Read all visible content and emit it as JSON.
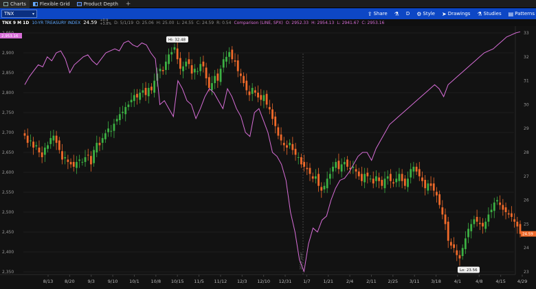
{
  "tabs": [
    {
      "label": "Charts",
      "active": true
    },
    {
      "label": "Flexible Grid",
      "active": false
    },
    {
      "label": "Product Depth",
      "active": false
    }
  ],
  "symbol_input": {
    "value": "TNX"
  },
  "toolbar": {
    "share": "Share",
    "flask": "",
    "d_label": "D",
    "style": "Style",
    "drawings": "Drawings",
    "studies": "Studies",
    "patterns": "Patterns"
  },
  "info": {
    "spec": "TNX 9 M 1D",
    "description": "10-YR TREASURY INDEX",
    "last": "24.59",
    "change_top": "+0.9",
    "change_bottom": "+3.8%",
    "ohlc": [
      "D: 5/1/19",
      "O: 25.06",
      "H: 25.00",
      "L: 24.55",
      "C: 24.59",
      "R: 0.54"
    ],
    "comparison_label": "Comparison (LINE, SPX)",
    "comparison_values": [
      "O: 2952.33",
      "H: 2954.13",
      "L: 2941.67",
      "C: 2953.16"
    ]
  },
  "colors": {
    "up": "#3cb043",
    "down": "#f06a2a",
    "comparison": "#d86ed8",
    "toolbar_bg": "#0d47c5"
  },
  "chart_data": {
    "type": "line",
    "description_series": [
      {
        "name": "TNX",
        "kind": "candlestick",
        "axis": "right"
      },
      {
        "name": "SPX",
        "kind": "line",
        "axis": "left"
      }
    ],
    "left_axis": {
      "ticks": [
        "2,950",
        "2,900",
        "2,850",
        "2,800",
        "2,750",
        "2,700",
        "2,650",
        "2,600",
        "2,550",
        "2,500",
        "2,450",
        "2,400",
        "2,350"
      ],
      "range": [
        2350,
        2950
      ],
      "current_label": "2,953.16"
    },
    "right_axis": {
      "ticks": [
        "33",
        "32",
        "31",
        "30",
        "29",
        "28",
        "27",
        "26",
        "25",
        "24",
        "23"
      ],
      "range": [
        23,
        33
      ],
      "current_label": "24.59"
    },
    "x_labels": [
      "8/13",
      "8/20",
      "9/3",
      "9/10",
      "10/1",
      "10/8",
      "10/15",
      "11/5",
      "11/12",
      "12/3",
      "12/10",
      "12/31",
      "1/7",
      "1/21",
      "2/4",
      "2/11",
      "2/25",
      "3/11",
      "3/18",
      "4/1",
      "4/8",
      "4/15",
      "4/29"
    ],
    "annotations": [
      {
        "text": "Hi: 32.48"
      },
      {
        "text": "Lo: 23.56"
      },
      {
        "text": "2019 year"
      }
    ],
    "tnx_close": [
      28.7,
      28.4,
      28.5,
      28.2,
      28.3,
      28.0,
      27.8,
      28.2,
      28.3,
      28.6,
      28.7,
      28.4,
      28.1,
      27.7,
      27.8,
      27.6,
      27.5,
      27.4,
      27.6,
      27.7,
      27.6,
      27.8,
      27.9,
      27.5,
      28.1,
      28.4,
      28.3,
      28.6,
      28.8,
      29.0,
      28.9,
      29.2,
      29.4,
      29.6,
      29.7,
      29.9,
      30.0,
      30.2,
      30.4,
      30.3,
      30.5,
      30.6,
      30.4,
      30.7,
      30.6,
      31.0,
      31.3,
      31.5,
      31.4,
      31.8,
      32.1,
      32.2,
      32.4,
      31.9,
      31.5,
      31.6,
      31.8,
      31.7,
      31.3,
      31.5,
      31.4,
      31.7,
      31.6,
      31.1,
      30.7,
      30.9,
      31.2,
      31.0,
      31.5,
      31.9,
      32.0,
      32.2,
      31.9,
      31.8,
      31.4,
      31.2,
      30.9,
      30.6,
      30.4,
      30.7,
      30.5,
      30.3,
      30.2,
      30.4,
      30.0,
      29.8,
      29.4,
      29.1,
      28.7,
      28.5,
      28.3,
      28.2,
      28.4,
      28.1,
      27.9,
      27.8,
      27.5,
      27.4,
      27.3,
      27.1,
      26.9,
      27.0,
      26.6,
      26.4,
      26.6,
      26.9,
      27.1,
      27.4,
      27.6,
      27.3,
      27.5,
      27.6,
      27.4,
      27.3,
      27.4,
      27.2,
      27.0,
      26.8,
      27.1,
      27.0,
      26.9,
      26.7,
      27.0,
      26.8,
      26.6,
      26.9,
      27.0,
      26.8,
      26.7,
      26.9,
      27.1,
      26.8,
      26.6,
      26.9,
      27.3,
      27.4,
      27.2,
      27.0,
      26.8,
      26.5,
      26.7,
      26.6,
      26.4,
      26.2,
      25.8,
      25.4,
      25.0,
      24.3,
      24.1,
      24.0,
      23.7,
      23.56,
      24.0,
      24.4,
      24.8,
      25.0,
      25.2,
      25.1,
      25.0,
      24.9,
      25.1,
      25.4,
      25.6,
      25.9,
      26.0,
      25.8,
      25.6,
      25.5,
      25.4,
      25.3,
      25.1,
      24.9,
      24.59
    ],
    "spx_close": [
      2820,
      2840,
      2855,
      2870,
      2865,
      2890,
      2880,
      2900,
      2905,
      2885,
      2850,
      2870,
      2880,
      2890,
      2895,
      2880,
      2870,
      2885,
      2900,
      2905,
      2910,
      2905,
      2925,
      2930,
      2920,
      2915,
      2925,
      2920,
      2900,
      2885,
      2770,
      2780,
      2760,
      2740,
      2830,
      2810,
      2780,
      2770,
      2735,
      2760,
      2790,
      2810,
      2800,
      2780,
      2760,
      2810,
      2790,
      2760,
      2740,
      2700,
      2690,
      2750,
      2760,
      2730,
      2700,
      2650,
      2640,
      2620,
      2580,
      2500,
      2450,
      2380,
      2351,
      2420,
      2460,
      2450,
      2480,
      2490,
      2530,
      2560,
      2580,
      2585,
      2600,
      2620,
      2640,
      2650,
      2650,
      2630,
      2660,
      2680,
      2700,
      2720,
      2730,
      2740,
      2750,
      2760,
      2770,
      2780,
      2790,
      2800,
      2810,
      2820,
      2810,
      2790,
      2820,
      2830,
      2840,
      2850,
      2860,
      2870,
      2880,
      2890,
      2900,
      2905,
      2910,
      2920,
      2930,
      2940,
      2945,
      2950,
      2953
    ]
  }
}
